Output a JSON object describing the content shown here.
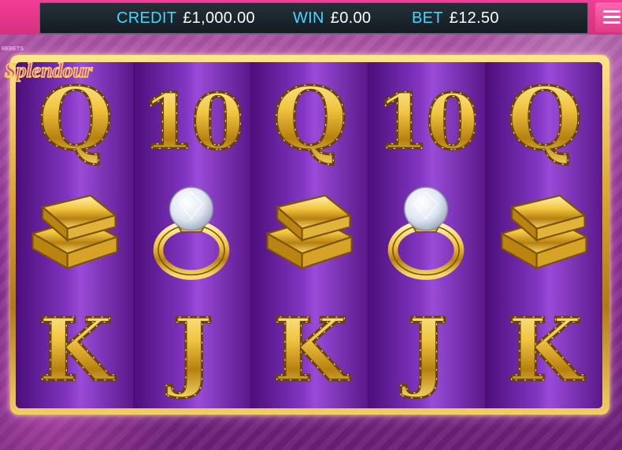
{
  "status": {
    "credit_label": "CREDIT",
    "credit_value": "£1,000.00",
    "win_label": "WIN",
    "win_value": "£0.00",
    "bet_label": "BET",
    "bet_value": "£12.50"
  },
  "logo": {
    "top_text": "REBETS",
    "title": "Splendour"
  },
  "colors": {
    "label": "#41d7ff",
    "frame_gold": "#d9a427",
    "reel_purple": "#8236c2",
    "menu_pink": "#e23c8c"
  },
  "reels": [
    [
      "Q",
      "gold-bars",
      "K"
    ],
    [
      "10",
      "diamond-ring",
      "J"
    ],
    [
      "Q",
      "gold-bars",
      "K"
    ],
    [
      "10",
      "diamond-ring",
      "J"
    ],
    [
      "Q",
      "gold-bars",
      "K"
    ]
  ],
  "icons": {
    "menu": "hamburger-menu-icon"
  }
}
